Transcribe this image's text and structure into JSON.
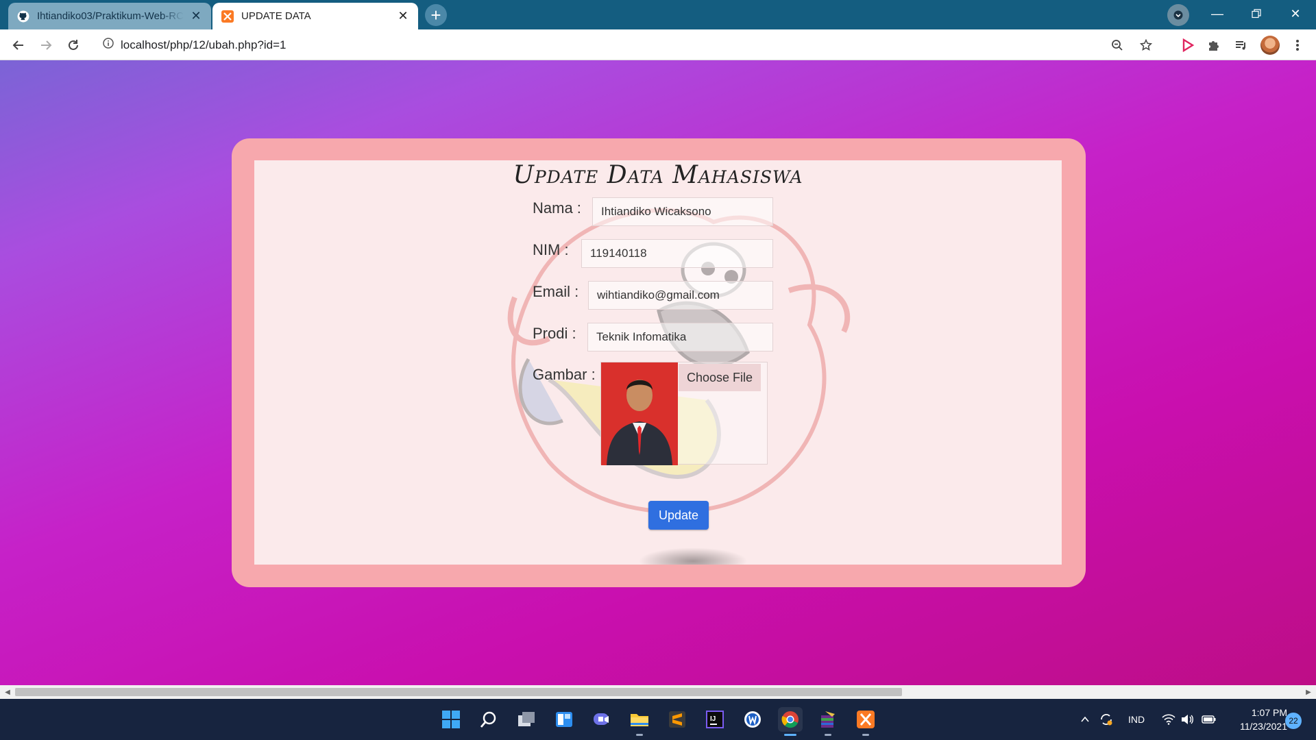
{
  "browser": {
    "tabs": [
      {
        "title": "Ihtiandiko03/Praktikum-Web-RC",
        "active": false,
        "icon": "github-icon"
      },
      {
        "title": "UPDATE DATA",
        "active": true,
        "icon": "xampp-icon"
      }
    ],
    "url": "localhost/php/12/ubah.php?id=1"
  },
  "form": {
    "title": "Update Data Mahasiswa",
    "nama_label": "Nama :",
    "nama_value": "Ihtiandiko Wicaksono",
    "nim_label": "NIM :",
    "nim_value": "119140118",
    "email_label": "Email :",
    "email_value": "wihtiandiko@gmail.com",
    "prodi_label": "Prodi :",
    "prodi_value": "Teknik Infomatika",
    "gambar_label": "Gambar :",
    "choose_file_label": "Choose File",
    "update_label": "Update"
  },
  "taskbar": {
    "language": "IND",
    "time": "1:07 PM",
    "date": "11/23/2021",
    "notifications": "22"
  },
  "colors": {
    "page_gradient_top": "#7b64d6",
    "page_gradient_bottom": "#c90fae",
    "card_border": "#f7a8ad",
    "update_button": "#2f6fe0"
  }
}
